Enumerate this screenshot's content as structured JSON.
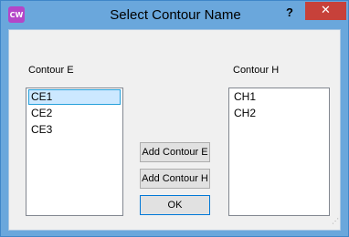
{
  "window": {
    "title": "Select Contour Name",
    "app_icon_text": "CW",
    "help_label": "?",
    "close_label": "✕"
  },
  "contour_e": {
    "label": "Contour E",
    "items": [
      {
        "label": "CE1",
        "selected": true
      },
      {
        "label": "CE2",
        "selected": false
      },
      {
        "label": "CE3",
        "selected": false
      }
    ]
  },
  "contour_h": {
    "label": "Contour H",
    "items": [
      {
        "label": "CH1",
        "selected": false
      },
      {
        "label": "CH2",
        "selected": false
      }
    ]
  },
  "buttons": {
    "add_e": "Add Contour E",
    "add_h": "Add Contour H",
    "ok": "OK"
  },
  "colors": {
    "titlebar": "#6aa7dc",
    "close": "#c7413a",
    "selection": "#cce8ff",
    "selection_border": "#26a0da"
  }
}
